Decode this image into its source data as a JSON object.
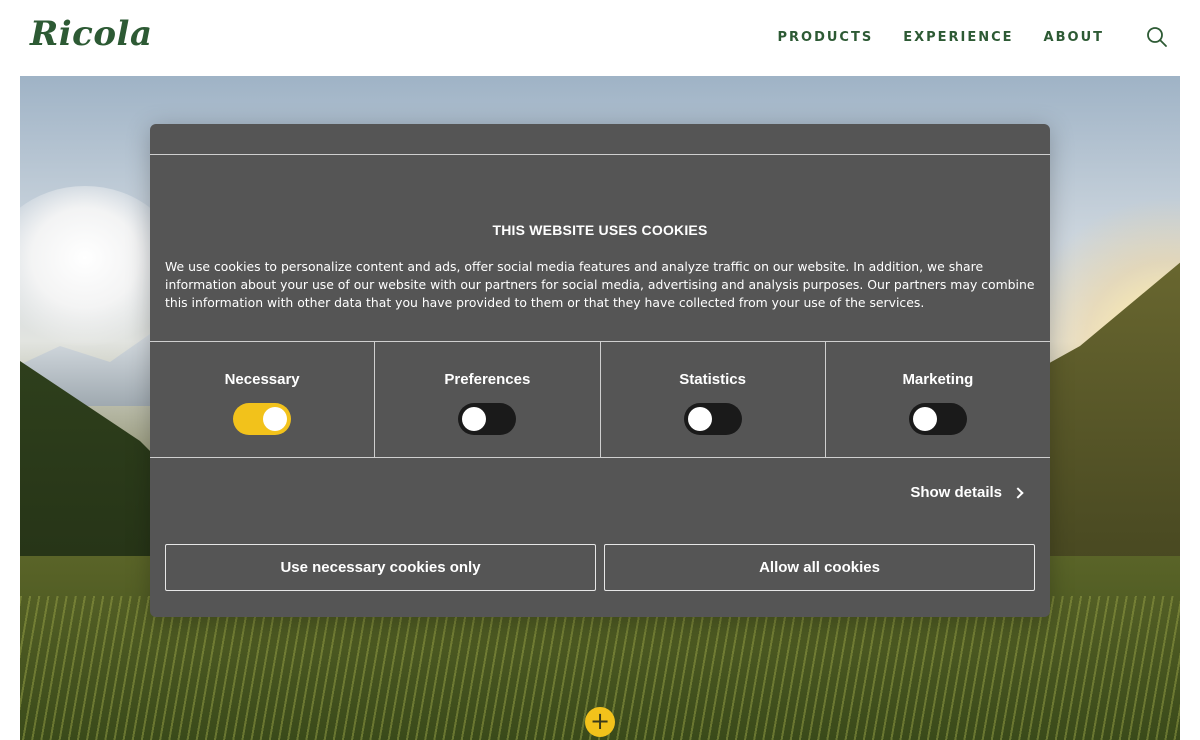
{
  "brand": {
    "logo_text": "Ricola",
    "color": "#2d5a34"
  },
  "nav": {
    "items": [
      "PRODUCTS",
      "EXPERIENCE",
      "ABOUT"
    ],
    "search_icon": "search-icon"
  },
  "hero": {
    "expand_icon": "plus-icon",
    "expand_symbol": "+",
    "accent": "#f2c21b"
  },
  "cookie_dialog": {
    "title": "THIS WEBSITE USES COOKIES",
    "body": "We use cookies to personalize content and ads, offer social media features and analyze traffic on our website. In addition, we share information about your use of our website with our partners for social media, advertising and analysis purposes. Our partners may combine this information with other data that you have provided to them or that they have collected from your use of the services.",
    "categories": [
      {
        "label": "Necessary",
        "enabled": true
      },
      {
        "label": "Preferences",
        "enabled": false
      },
      {
        "label": "Statistics",
        "enabled": false
      },
      {
        "label": "Marketing",
        "enabled": false
      }
    ],
    "show_details": "Show details",
    "buttons": {
      "necessary_only": "Use necessary cookies only",
      "allow_all": "Allow all cookies"
    },
    "background": "#555555"
  }
}
